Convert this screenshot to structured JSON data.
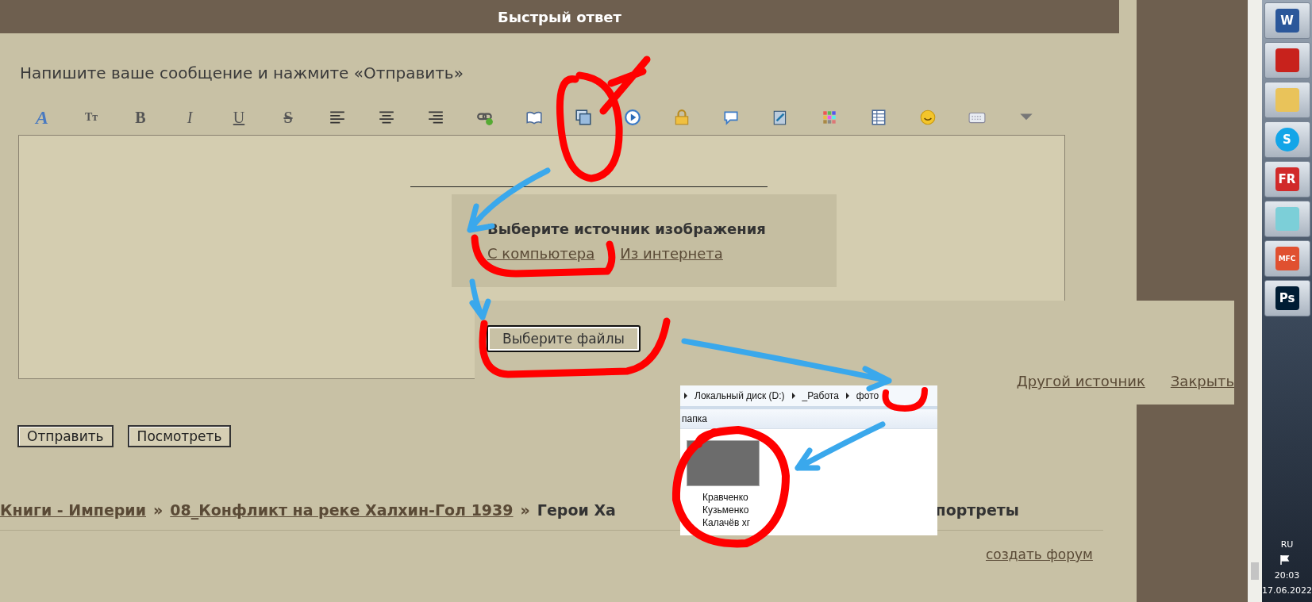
{
  "header": {
    "title": "Быстрый ответ"
  },
  "prompt": "Напишите ваше сообщение и нажмите «Отправить»",
  "toolbar": [
    {
      "kind": "font",
      "glyph": "A"
    },
    {
      "kind": "size",
      "glyph": "Tт"
    },
    {
      "kind": "bold",
      "glyph": "B"
    },
    {
      "kind": "italic",
      "glyph": "I"
    },
    {
      "kind": "underline",
      "glyph": "U"
    },
    {
      "kind": "strike",
      "glyph": "S"
    },
    {
      "kind": "align-left"
    },
    {
      "kind": "align-center"
    },
    {
      "kind": "align-right"
    },
    {
      "kind": "link"
    },
    {
      "kind": "book"
    },
    {
      "kind": "image"
    },
    {
      "kind": "play"
    },
    {
      "kind": "lock"
    },
    {
      "kind": "speech"
    },
    {
      "kind": "media"
    },
    {
      "kind": "color"
    },
    {
      "kind": "table"
    },
    {
      "kind": "smiley"
    },
    {
      "kind": "keyboard"
    },
    {
      "kind": "more"
    }
  ],
  "image_source": {
    "title": "Выберите источник изображения",
    "links": [
      "С компьютера",
      "Из интернета"
    ]
  },
  "file_panel": {
    "button": "Выберите файлы",
    "links": [
      "Другой источник",
      "Закрыть"
    ]
  },
  "explorer": {
    "path": [
      "Локальный диск (D:)",
      "_Работа",
      "фото"
    ],
    "toolbar_text": "папка",
    "file_name_lines": [
      "Кравченко",
      "Кузьменко",
      "Калачёв хг"
    ]
  },
  "buttons": [
    "Отправить",
    "Посмотреть"
  ],
  "breadcrumb": {
    "links": [
      "Книги - Империи",
      "08_Конфликт на реке Халхин-Гол 1939"
    ],
    "separator": "»",
    "current_parts": [
      "Герои Ха",
      "портреты"
    ]
  },
  "footer_link": "создать форум",
  "taskbar": {
    "apps": [
      {
        "kind": "word",
        "glyph": "W"
      },
      {
        "kind": "pdf"
      },
      {
        "kind": "folder"
      },
      {
        "kind": "skype",
        "glyph": "S"
      },
      {
        "kind": "fr",
        "glyph": "FR"
      },
      {
        "kind": "notes"
      },
      {
        "kind": "cubes",
        "glyph": "MFC"
      },
      {
        "kind": "ps",
        "glyph": "Ps"
      }
    ],
    "language": "RU",
    "time": "20:03",
    "date": "17.06.2022"
  }
}
